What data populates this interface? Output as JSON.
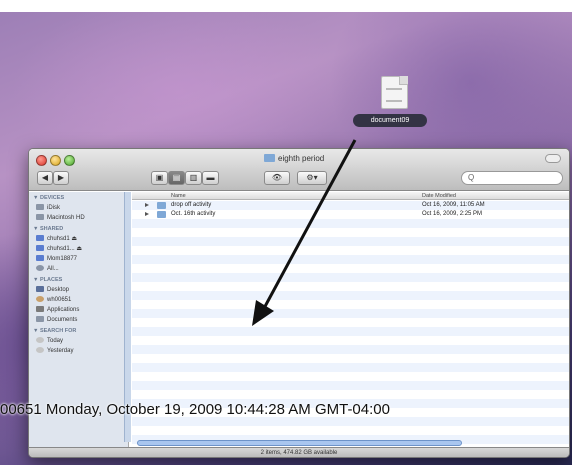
{
  "desktop": {
    "file_icon": {
      "icon": "document-icon",
      "label": "document09"
    }
  },
  "finder": {
    "title": "eighth period",
    "toolbar": {
      "back_label": "◀",
      "forward_label": "▶",
      "view_icons": "▣",
      "view_list": "▤",
      "view_columns": "▥",
      "view_coverflow": "▬",
      "quicklook_label": "👁",
      "action_label": "⚙▾",
      "search_placeholder": "Q"
    },
    "sidebar": {
      "sections": [
        {
          "heading": "▼ DEVICES",
          "items": [
            "iDisk",
            "Macintosh HD"
          ]
        },
        {
          "heading": "▼ SHARED",
          "items": [
            "chuhsd1 ⏏",
            "chuhsd1... ⏏",
            "Mom18877",
            "All..."
          ]
        },
        {
          "heading": "▼ PLACES",
          "items": [
            "Desktop",
            "wh00651",
            "Applications",
            "Documents"
          ]
        },
        {
          "heading": "▼ SEARCH FOR",
          "items": [
            "Today",
            "Yesterday"
          ]
        }
      ]
    },
    "columns": {
      "name": "Name",
      "date": "Date Modified"
    },
    "rows": [
      {
        "name": "drop off activity",
        "date": "Oct 16, 2009, 11:05 AM"
      },
      {
        "name": "Oct. 16th activity",
        "date": "Oct 16, 2009, 2:25 PM"
      }
    ],
    "status": "2 items, 474.82 GB available"
  },
  "overlay_timestamp": "00651   Monday, October 19, 2009 10:44:28 AM GMT-04:00"
}
